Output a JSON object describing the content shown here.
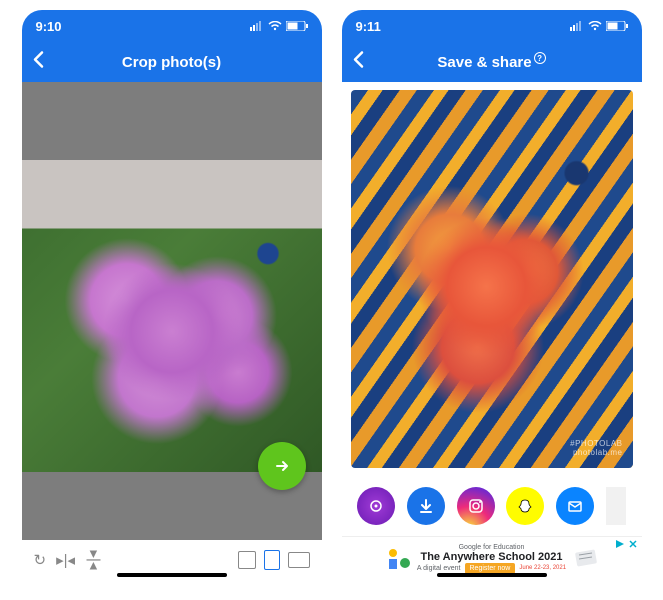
{
  "left": {
    "status": {
      "time": "9:10"
    },
    "nav": {
      "title": "Crop photo(s)"
    },
    "watermark": {
      "brand": "",
      "site": ""
    }
  },
  "right": {
    "status": {
      "time": "9:11"
    },
    "nav": {
      "title": "Save & share",
      "help": "?"
    },
    "watermark": {
      "brand": "#PHOTOLAB",
      "site": "photolab.me"
    },
    "ad": {
      "provider": "Google for Education",
      "title": "The Anywhere School 2021",
      "sub": "A digital event",
      "dates": "June 22-23, 2021",
      "cta": "Register now"
    }
  },
  "colors": {
    "primary": "#1a73e8",
    "fab": "#5fc51d",
    "download": "#1a73e8",
    "purple": "#8a3ab9",
    "instagram_a": "#f58529",
    "instagram_b": "#dd2a7b",
    "instagram_c": "#515bd4",
    "snapchat": "#fffc00",
    "mail": "#0a84ff"
  }
}
